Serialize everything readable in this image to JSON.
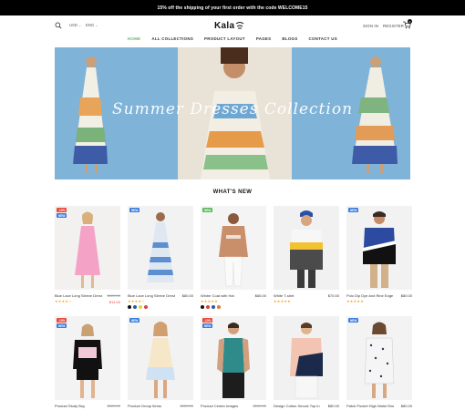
{
  "announcement": "15% off the shipping of your first order with the code WELCOME15",
  "header": {
    "currency": "USD",
    "language": "ENG",
    "logo": "Kala",
    "signin": "SIGN IN",
    "register": "REGISTER",
    "cart_count": "0"
  },
  "nav": {
    "items": [
      "HOME",
      "ALL COLLECTIONS",
      "PRODUCT LAYOUT",
      "PAGES",
      "BLOGS",
      "CONTACT US"
    ],
    "active": "HOME"
  },
  "banner": {
    "title": "Summer Dresses Collection"
  },
  "section_title": "WHAT'S NEW",
  "colors": {
    "accent": "#5cb85c",
    "sale": "#e74c3c",
    "new": "#3b7ddd",
    "star": "#f5a623"
  },
  "products": [
    {
      "name": "Blue Lace Long Sleeve Dress",
      "price": "$120.00",
      "sale_price": "$14.00",
      "badges": [
        "-10%",
        "NEW"
      ],
      "stars": "★★★★☆"
    },
    {
      "name": "Blue Lace Long Sleeve Dress",
      "price": "$80.00",
      "badges": [
        "NEW"
      ],
      "stars": "★★★★☆"
    },
    {
      "name": "Winter Coat with Hat",
      "price": "$66.00",
      "badges": [
        "NEW"
      ],
      "stars": "★★★★★"
    },
    {
      "name": "White T-shirt",
      "price": "$70.00",
      "badges": [],
      "stars": "★★★★★"
    },
    {
      "name": "Polo Dip Dye And Rine Edge",
      "price": "$80.00",
      "badges": [
        "NEW"
      ],
      "stars": "★★★★★"
    },
    {
      "name": "Product Study Buy",
      "price": "$120.00",
      "badges": [
        "-10%",
        "NEW"
      ],
      "stars": "★★★★☆"
    },
    {
      "name": "Product Group Items",
      "price": "$120.00",
      "badges": [
        "NEW"
      ],
      "stars": "★★★★☆"
    },
    {
      "name": "Product Center Images",
      "price": "$120.00",
      "badges": [
        "-10%",
        "NEW"
      ],
      "stars": "★★★★☆"
    },
    {
      "name": "Design Cotton Smock Top In Stripe Orange",
      "price": "$80.00",
      "badges": [],
      "stars": "★★★★☆"
    },
    {
      "name": "Patch Pocket High Waist Shorts",
      "price": "$80.00",
      "badges": [
        "NEW"
      ],
      "stars": "★★★★☆"
    }
  ]
}
